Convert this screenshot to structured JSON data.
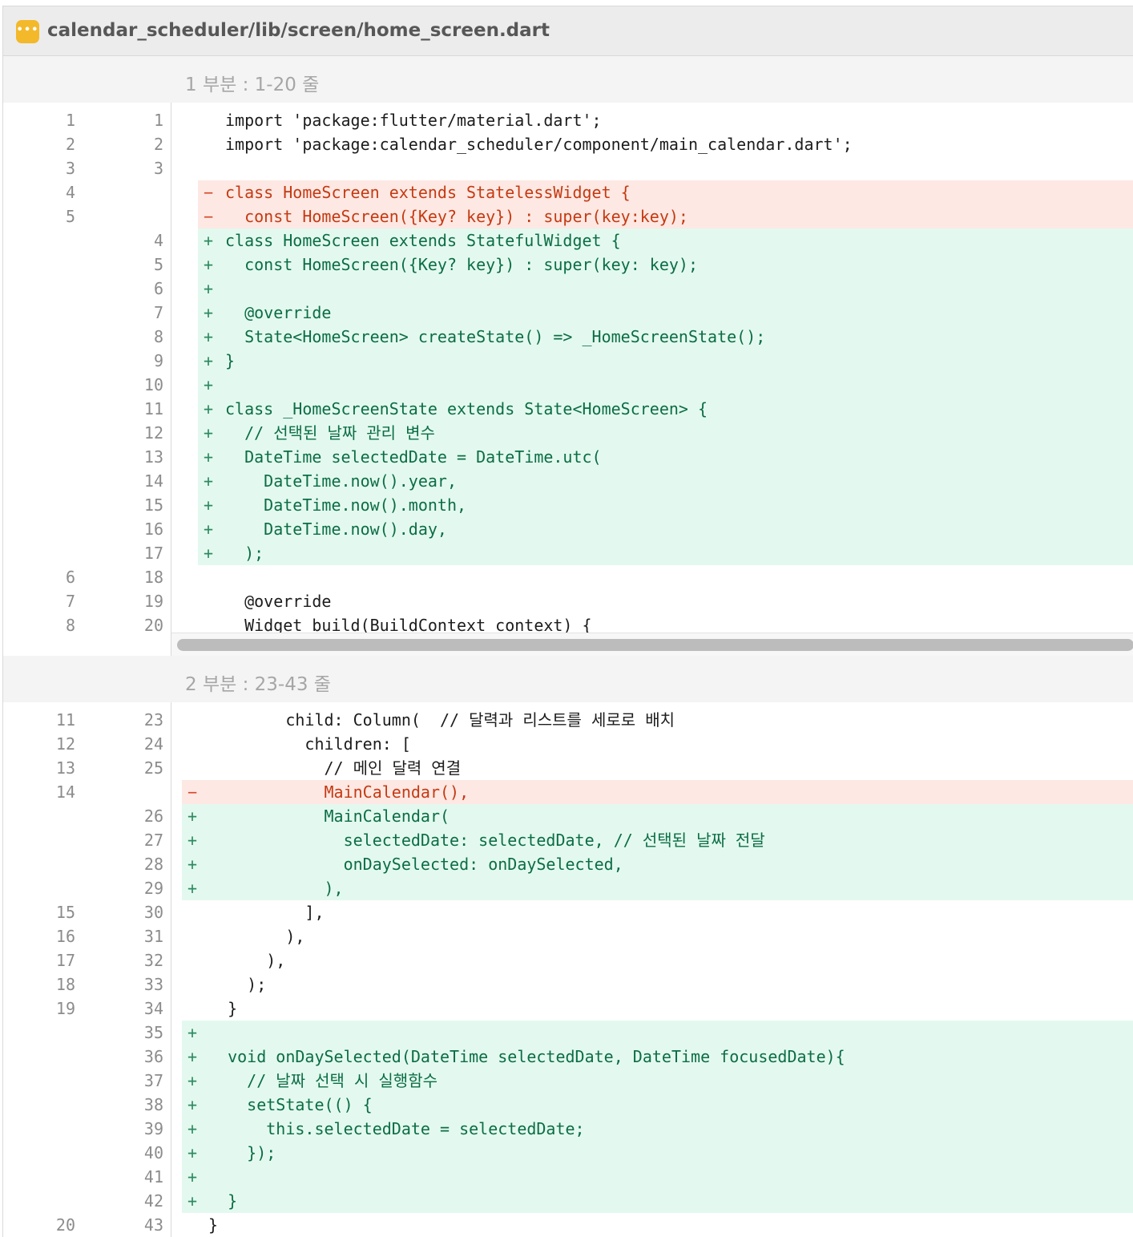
{
  "file": {
    "icon": "more-dots-icon",
    "icon_glyph": "•••",
    "path": "calendar_scheduler/lib/screen/home_screen.dart"
  },
  "colors": {
    "added_bg": "#e3f9ef",
    "removed_bg": "#fde8e3",
    "added_text": "#0c6d45",
    "removed_text": "#c43a12",
    "icon": "#f3b92a"
  },
  "hunks": [
    {
      "label": "1 부분 : 1-20 줄",
      "lines": [
        {
          "old": "1",
          "new": "1",
          "type": "ctx",
          "mark": "",
          "text": "import 'package:flutter/material.dart';"
        },
        {
          "old": "2",
          "new": "2",
          "type": "ctx",
          "mark": "",
          "text": "import 'package:calendar_scheduler/component/main_calendar.dart';"
        },
        {
          "old": "3",
          "new": "3",
          "type": "ctx",
          "mark": "",
          "text": ""
        },
        {
          "old": "4",
          "new": "",
          "type": "del",
          "mark": "−",
          "text": "class HomeScreen extends StatelessWidget {"
        },
        {
          "old": "5",
          "new": "",
          "type": "del",
          "mark": "−",
          "text": "  const HomeScreen({Key? key}) : super(key:key);"
        },
        {
          "old": "",
          "new": "4",
          "type": "add",
          "mark": "+",
          "text": "class HomeScreen extends StatefulWidget {"
        },
        {
          "old": "",
          "new": "5",
          "type": "add",
          "mark": "+",
          "text": "  const HomeScreen({Key? key}) : super(key: key);"
        },
        {
          "old": "",
          "new": "6",
          "type": "add",
          "mark": "+",
          "text": ""
        },
        {
          "old": "",
          "new": "7",
          "type": "add",
          "mark": "+",
          "text": "  @override"
        },
        {
          "old": "",
          "new": "8",
          "type": "add",
          "mark": "+",
          "text": "  State<HomeScreen> createState() => _HomeScreenState();"
        },
        {
          "old": "",
          "new": "9",
          "type": "add",
          "mark": "+",
          "text": "}"
        },
        {
          "old": "",
          "new": "10",
          "type": "add",
          "mark": "+",
          "text": ""
        },
        {
          "old": "",
          "new": "11",
          "type": "add",
          "mark": "+",
          "text": "class _HomeScreenState extends State<HomeScreen> {"
        },
        {
          "old": "",
          "new": "12",
          "type": "add",
          "mark": "+",
          "text": "  // 선택된 날짜 관리 변수"
        },
        {
          "old": "",
          "new": "13",
          "type": "add",
          "mark": "+",
          "text": "  DateTime selectedDate = DateTime.utc("
        },
        {
          "old": "",
          "new": "14",
          "type": "add",
          "mark": "+",
          "text": "    DateTime.now().year,"
        },
        {
          "old": "",
          "new": "15",
          "type": "add",
          "mark": "+",
          "text": "    DateTime.now().month,"
        },
        {
          "old": "",
          "new": "16",
          "type": "add",
          "mark": "+",
          "text": "    DateTime.now().day,"
        },
        {
          "old": "",
          "new": "17",
          "type": "add",
          "mark": "+",
          "text": "  );"
        },
        {
          "old": "6",
          "new": "18",
          "type": "ctx",
          "mark": "",
          "text": ""
        },
        {
          "old": "7",
          "new": "19",
          "type": "ctx",
          "mark": "",
          "text": "  @override"
        },
        {
          "old": "8",
          "new": "20",
          "type": "ctx",
          "mark": "",
          "text": "  Widget build(BuildContext context) {"
        }
      ]
    },
    {
      "label": "2 부분 : 23-43 줄",
      "lines": [
        {
          "old": "11",
          "new": "23",
          "type": "ctx",
          "mark": "",
          "text": "        child: Column(  // 달력과 리스트를 세로로 배치"
        },
        {
          "old": "12",
          "new": "24",
          "type": "ctx",
          "mark": "",
          "text": "          children: ["
        },
        {
          "old": "13",
          "new": "25",
          "type": "ctx",
          "mark": "",
          "text": "            // 메인 달력 연결"
        },
        {
          "old": "14",
          "new": "",
          "type": "del",
          "mark": "−",
          "text": "            MainCalendar(),"
        },
        {
          "old": "",
          "new": "26",
          "type": "add",
          "mark": "+",
          "text": "            MainCalendar("
        },
        {
          "old": "",
          "new": "27",
          "type": "add",
          "mark": "+",
          "text": "              selectedDate: selectedDate, // 선택된 날짜 전달"
        },
        {
          "old": "",
          "new": "28",
          "type": "add",
          "mark": "+",
          "text": "              onDaySelected: onDaySelected,"
        },
        {
          "old": "",
          "new": "29",
          "type": "add",
          "mark": "+",
          "text": "            ),"
        },
        {
          "old": "15",
          "new": "30",
          "type": "ctx",
          "mark": "",
          "text": "          ],"
        },
        {
          "old": "16",
          "new": "31",
          "type": "ctx",
          "mark": "",
          "text": "        ),"
        },
        {
          "old": "17",
          "new": "32",
          "type": "ctx",
          "mark": "",
          "text": "      ),"
        },
        {
          "old": "18",
          "new": "33",
          "type": "ctx",
          "mark": "",
          "text": "    );"
        },
        {
          "old": "19",
          "new": "34",
          "type": "ctx",
          "mark": "",
          "text": "  }"
        },
        {
          "old": "",
          "new": "35",
          "type": "add",
          "mark": "+",
          "text": ""
        },
        {
          "old": "",
          "new": "36",
          "type": "add",
          "mark": "+",
          "text": "  void onDaySelected(DateTime selectedDate, DateTime focusedDate){"
        },
        {
          "old": "",
          "new": "37",
          "type": "add",
          "mark": "+",
          "text": "    // 날짜 선택 시 실행함수"
        },
        {
          "old": "",
          "new": "38",
          "type": "add",
          "mark": "+",
          "text": "    setState(() {"
        },
        {
          "old": "",
          "new": "39",
          "type": "add",
          "mark": "+",
          "text": "      this.selectedDate = selectedDate;"
        },
        {
          "old": "",
          "new": "40",
          "type": "add",
          "mark": "+",
          "text": "    });"
        },
        {
          "old": "",
          "new": "41",
          "type": "add",
          "mark": "+",
          "text": ""
        },
        {
          "old": "",
          "new": "42",
          "type": "add",
          "mark": "+",
          "text": "  }"
        },
        {
          "old": "20",
          "new": "43",
          "type": "ctx",
          "mark": "",
          "text": "}"
        }
      ]
    }
  ]
}
